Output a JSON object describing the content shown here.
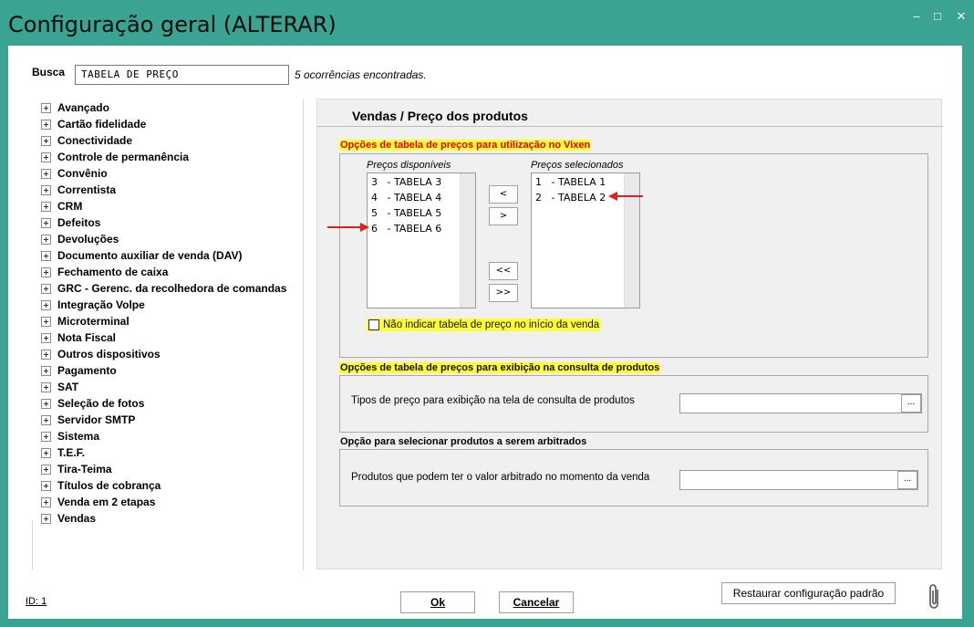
{
  "window": {
    "title": "Configuração geral (ALTERAR)",
    "controls": {
      "minimize": "–",
      "maximize": "□",
      "close": "✕"
    },
    "accent_color": "#3aa391"
  },
  "search": {
    "label": "Busca",
    "value": "TABELA DE PREÇO",
    "result": "5 ocorrências encontradas."
  },
  "sidebar": {
    "items": [
      {
        "label": "Avançado"
      },
      {
        "label": "Cartão fidelidade"
      },
      {
        "label": "Conectividade"
      },
      {
        "label": "Controle de permanência"
      },
      {
        "label": "Convênio"
      },
      {
        "label": "Correntista"
      },
      {
        "label": "CRM"
      },
      {
        "label": "Defeitos"
      },
      {
        "label": "Devoluções"
      },
      {
        "label": "Documento auxiliar de venda (DAV)"
      },
      {
        "label": "Fechamento de caixa"
      },
      {
        "label": "GRC - Gerenc. da recolhedora de comandas"
      },
      {
        "label": "Integração Volpe"
      },
      {
        "label": "Microterminal"
      },
      {
        "label": "Nota Fiscal"
      },
      {
        "label": "Outros dispositivos"
      },
      {
        "label": "Pagamento"
      },
      {
        "label": "SAT"
      },
      {
        "label": "Seleção de fotos"
      },
      {
        "label": "Servidor SMTP"
      },
      {
        "label": "Sistema"
      },
      {
        "label": "T.E.F."
      },
      {
        "label": "Tira-Teima"
      },
      {
        "label": "Títulos de cobrança"
      },
      {
        "label": "Venda em 2 etapas"
      },
      {
        "label": "Vendas"
      }
    ]
  },
  "panel": {
    "title": "Vendas / Preço dos produtos",
    "group1": {
      "legend": "Opções de tabela de preços para utilização no Vixen",
      "available_label": "Preços disponíveis",
      "available": [
        "3   - TABELA 3",
        "4   - TABELA 4",
        "5   - TABELA 5",
        "6   - TABELA 6"
      ],
      "selected_label": "Preços selecionados",
      "selected": [
        "1   - TABELA 1",
        "2   - TABELA 2"
      ],
      "btn_move_left": "<",
      "btn_move_right": ">",
      "btn_move_all_left": "<<",
      "btn_move_all_right": ">>",
      "checkbox_label": "Não indicar tabela de preço no início da venda",
      "checkbox_checked": false
    },
    "group2": {
      "legend": "Opções de tabela de preços para exibição na consulta de produtos",
      "field_label": "Tipos de preço para exibição na tela de consulta de produtos",
      "field_value": "",
      "button": "..."
    },
    "group3": {
      "legend": "Opção para selecionar produtos a serem arbitrados",
      "field_label": "Produtos que podem ter o valor arbitrado no momento da venda",
      "field_value": "",
      "button": "..."
    }
  },
  "footer": {
    "id": "ID: 1",
    "ok": "Ok",
    "cancel": "Cancelar",
    "restore": "Restaurar configuração padrão"
  },
  "colors": {
    "highlight": "#ffff33",
    "legend_red": "#e00000",
    "annotation_arrow": "#e02020"
  }
}
